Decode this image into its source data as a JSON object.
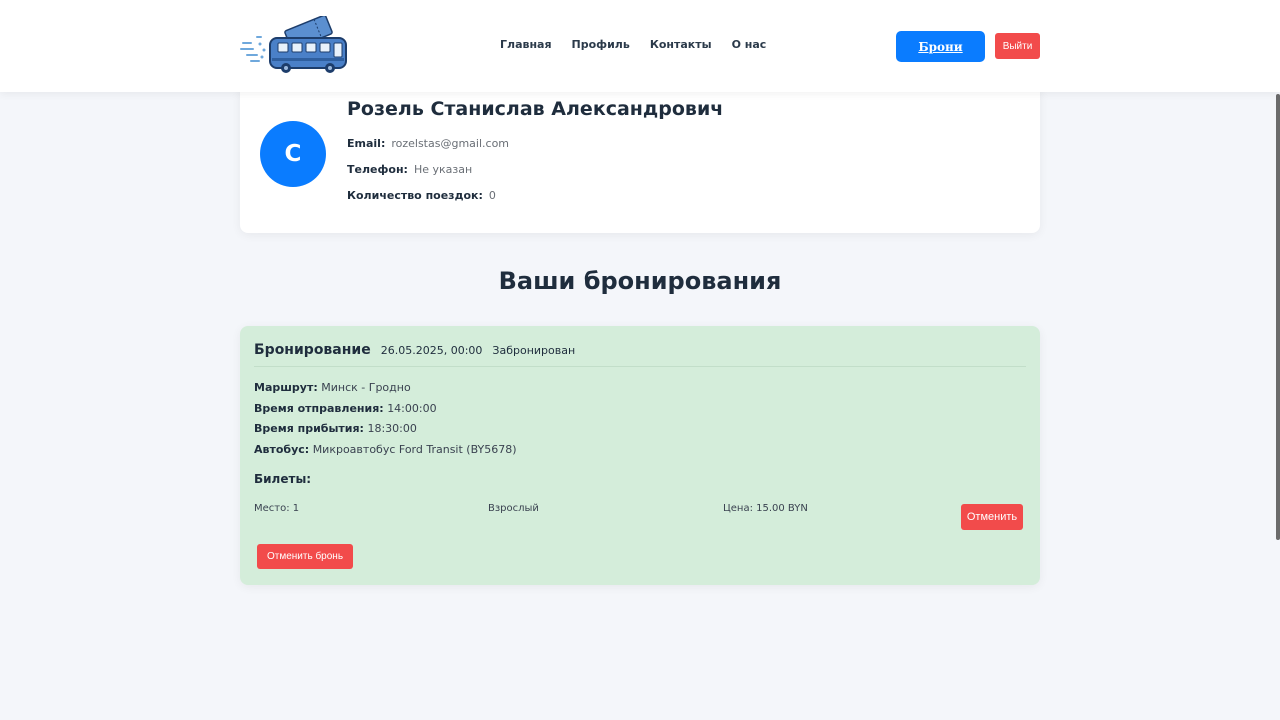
{
  "header": {
    "logo_icon": "bus-ticket-logo-icon",
    "nav": [
      "Главная",
      "Профиль",
      "Контакты",
      "О нас"
    ],
    "bookings_button": "Брони",
    "logout_button": "Выйти"
  },
  "profile": {
    "avatar_letter": "С",
    "name": "Розель Станислав Александрович",
    "email_label": "Email:",
    "email": "rozelstas@gmail.com",
    "phone_label": "Телефон:",
    "phone": "Не указан",
    "trips_label": "Количество поездок:",
    "trips": "0"
  },
  "bookings_title": "Ваши бронирования",
  "booking": {
    "title": "Бронирование",
    "date": "26.05.2025, 00:00",
    "status": "Забронирован",
    "route_label": "Маршрут:",
    "route": "Минск - Гродно",
    "departure_label": "Время отправления:",
    "departure": "14:00:00",
    "arrival_label": "Время прибытия:",
    "arrival": "18:30:00",
    "bus_label": "Автобус:",
    "bus": "Микроавтобус Ford Transit (BY5678)",
    "tickets_title": "Билеты:",
    "tickets": [
      {
        "seat": "Место: 1",
        "type": "Взрослый",
        "price": "Цена: 15.00 BYN",
        "cancel_label": "Отменить"
      }
    ],
    "cancel_booking_label": "Отменить бронь"
  },
  "colors": {
    "accent": "#0a7cff",
    "danger": "#f24b4b",
    "booked_card": "#d4edda",
    "background": "#f4f6fa"
  }
}
